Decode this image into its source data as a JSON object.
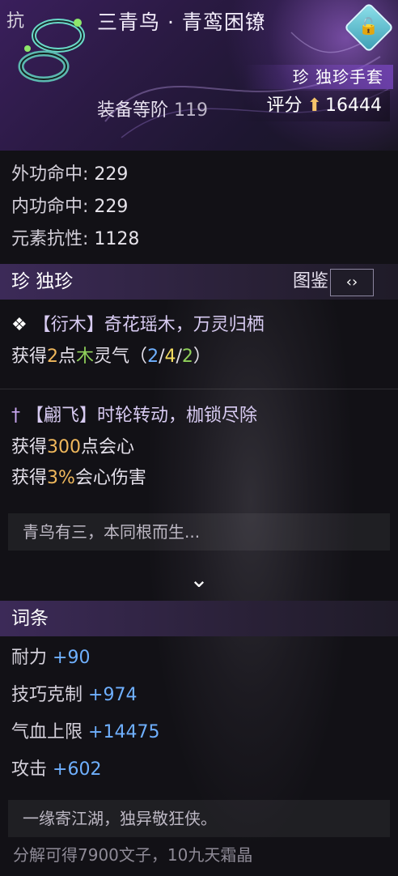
{
  "header": {
    "quality_char": "抗",
    "item_name": "三青鸟 · 青鸾困镣",
    "rarity_tag": "珍 独珍手套",
    "level_label": "装备等阶",
    "level_value": "119",
    "score_label": "评分",
    "score_value": "16444"
  },
  "stats": [
    {
      "label": "外功命中:",
      "value": "229"
    },
    {
      "label": "内功命中:",
      "value": "229"
    },
    {
      "label": "元素抗性:",
      "value": "1128"
    }
  ],
  "unique": {
    "header_title": "珍 独珍",
    "tujian_label": "图鉴",
    "effect1_title": "【衍木】奇花瑶木，万灵归栖",
    "effect1_prefix": "获得",
    "effect1_num": "2",
    "effect1_mid": "点",
    "effect1_element": "木",
    "effect1_suffix": "灵气（",
    "effect1_v1": "2",
    "effect1_slash1": "/",
    "effect1_v2": "4",
    "effect1_slash2": "/",
    "effect1_v3": "2",
    "effect1_close": "）",
    "effect2_title": "【翩飞】时轮转动，枷锁尽除",
    "effect2_line1_prefix": "获得",
    "effect2_line1_num": "300",
    "effect2_line1_suffix": "点会心",
    "effect2_line2_prefix": "获得",
    "effect2_line2_num": "3%",
    "effect2_line2_suffix": "会心伤害",
    "lore": "青鸟有三，本同根而生..."
  },
  "affixes": {
    "header_title": "词条",
    "items": [
      {
        "label": "耐力",
        "value": "+90"
      },
      {
        "label": "技巧克制",
        "value": "+974"
      },
      {
        "label": "气血上限",
        "value": "+14475"
      },
      {
        "label": "攻击",
        "value": "+602"
      }
    ],
    "lore": "一缘寄江湖，独异敬狂侠。"
  },
  "footer": "分解可得7900文子，10九天霜晶",
  "icons": {
    "item": "bracelet-gauntlet-icon",
    "lock": "unlock-icon",
    "score_arrow": "arrow-up-icon",
    "tujian": "chevron-right-icon",
    "expand": "chevron-down-icon",
    "wood": "wood-element-icon",
    "fly": "dagger-icon"
  },
  "colors": {
    "gold": "#f0b85c",
    "green": "#8fd05a",
    "blue": "#6fb0ff",
    "yellow": "#f4dc60",
    "accent": "#3c2a58"
  }
}
